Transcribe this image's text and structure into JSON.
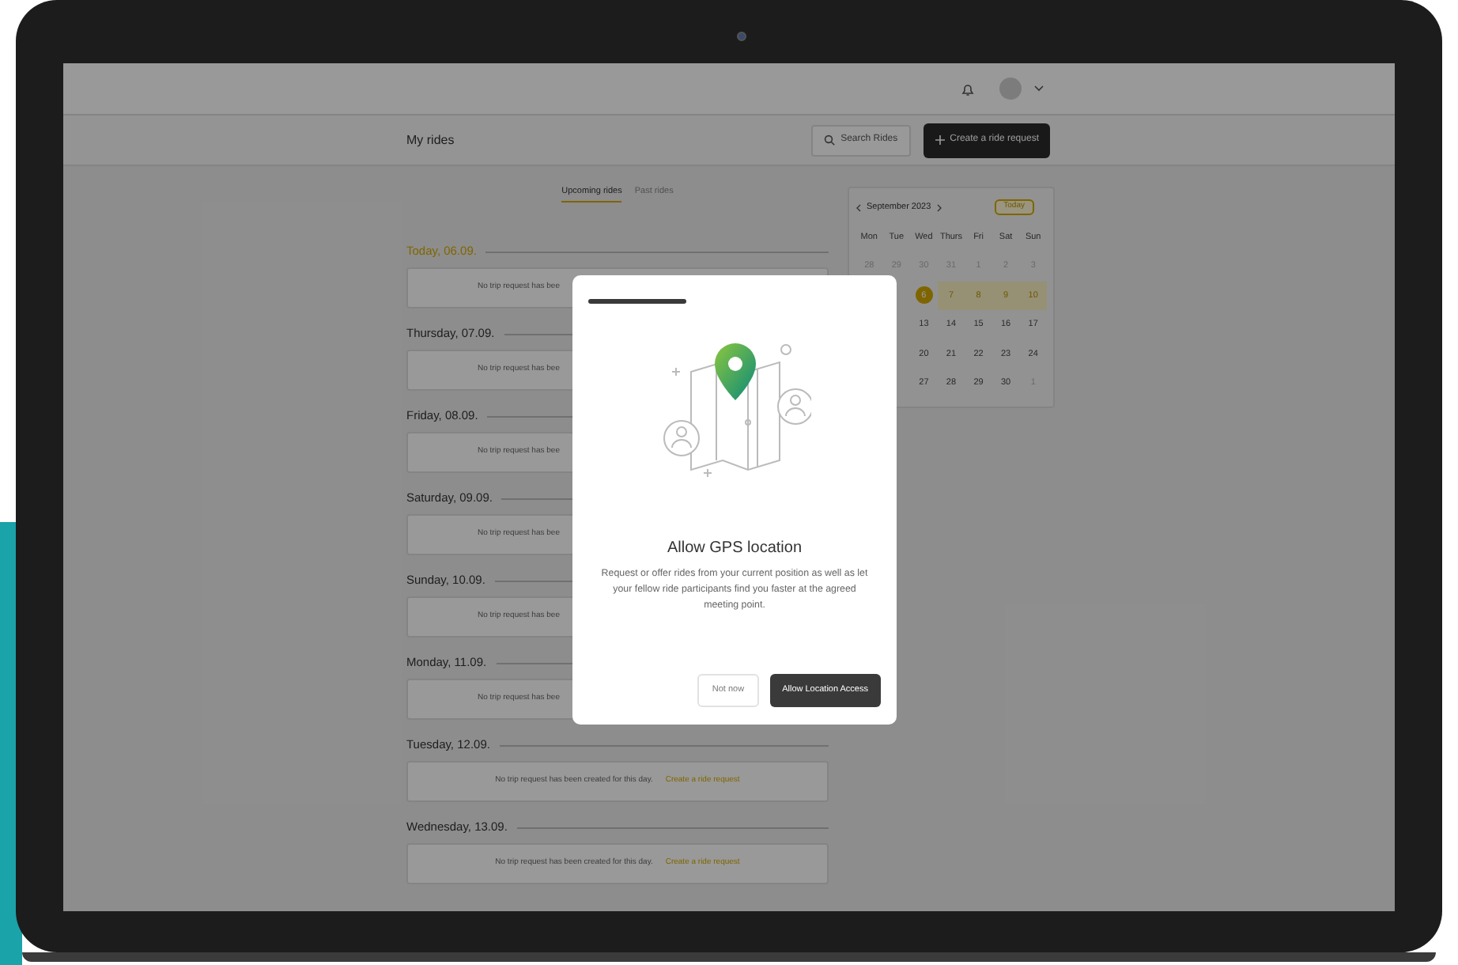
{
  "page_title": "My rides",
  "search_button": "Search Rides",
  "create_button": "Create a ride request",
  "tabs": [
    {
      "label": "Upcoming rides",
      "selected": true
    },
    {
      "label": "Past rides",
      "selected": false
    }
  ],
  "days": [
    {
      "heading": "Today, 06.09.",
      "today": true,
      "message": "No trip request has bee"
    },
    {
      "heading": "Thursday, 07.09.",
      "today": false,
      "message": "No trip request has bee"
    },
    {
      "heading": "Friday, 08.09.",
      "today": false,
      "message": "No trip request has bee"
    },
    {
      "heading": "Saturday, 09.09.",
      "today": false,
      "message": "No trip request has bee"
    },
    {
      "heading": "Sunday, 10.09.",
      "today": false,
      "message": "No trip request has bee"
    },
    {
      "heading": "Monday, 11.09.",
      "today": false,
      "message": "No trip request has bee"
    },
    {
      "heading": "Tuesday, 12.09.",
      "today": false,
      "message": "No trip request has been created for this day.",
      "link": "Create a ride request"
    },
    {
      "heading": "Wednesday, 13.09.",
      "today": false,
      "message": "No trip request has been created for this day.",
      "link": "Create a ride request"
    }
  ],
  "calendar": {
    "month": "September 2023",
    "today_button": "Today",
    "weekdays": [
      "Mon",
      "Tue",
      "Wed",
      "Thurs",
      "Fri",
      "Sat",
      "Sun"
    ],
    "weeks": [
      [
        {
          "text": "28",
          "muted": true,
          "selected": false,
          "highlighted": false
        },
        {
          "text": "29",
          "muted": true,
          "selected": false,
          "highlighted": false
        },
        {
          "text": "30",
          "muted": true,
          "selected": false,
          "highlighted": false
        },
        {
          "text": "31",
          "muted": true,
          "selected": false,
          "highlighted": false
        },
        {
          "text": "1",
          "muted": true,
          "selected": false,
          "highlighted": false
        },
        {
          "text": "2",
          "muted": true,
          "selected": false,
          "highlighted": false
        },
        {
          "text": "3",
          "muted": true,
          "selected": false,
          "highlighted": false
        }
      ],
      [
        {
          "text": "6",
          "muted": false,
          "selected": true,
          "highlighted": false
        },
        {
          "text": "7",
          "muted": false,
          "selected": false,
          "highlighted": true
        },
        {
          "text": "8",
          "muted": false,
          "selected": false,
          "highlighted": true
        },
        {
          "text": "9",
          "muted": false,
          "selected": false,
          "highlighted": true
        },
        {
          "text": "10",
          "muted": false,
          "selected": false,
          "highlighted": true
        }
      ],
      [
        {
          "text": "13",
          "muted": false,
          "selected": false,
          "highlighted": false
        },
        {
          "text": "14",
          "muted": false,
          "selected": false,
          "highlighted": false
        },
        {
          "text": "15",
          "muted": false,
          "selected": false,
          "highlighted": false
        },
        {
          "text": "16",
          "muted": false,
          "selected": false,
          "highlighted": false
        },
        {
          "text": "17",
          "muted": false,
          "selected": false,
          "highlighted": false
        }
      ],
      [
        {
          "text": "20",
          "muted": false,
          "selected": false,
          "highlighted": false
        },
        {
          "text": "21",
          "muted": false,
          "selected": false,
          "highlighted": false
        },
        {
          "text": "22",
          "muted": false,
          "selected": false,
          "highlighted": false
        },
        {
          "text": "23",
          "muted": false,
          "selected": false,
          "highlighted": false
        },
        {
          "text": "24",
          "muted": false,
          "selected": false,
          "highlighted": false
        }
      ],
      [
        {
          "text": "27",
          "muted": false,
          "selected": false,
          "highlighted": false
        },
        {
          "text": "28",
          "muted": false,
          "selected": false,
          "highlighted": false
        },
        {
          "text": "29",
          "muted": false,
          "selected": false,
          "highlighted": false
        },
        {
          "text": "30",
          "muted": false,
          "selected": false,
          "highlighted": false
        },
        {
          "text": "1",
          "muted": true,
          "selected": false,
          "highlighted": false
        }
      ]
    ]
  },
  "modal": {
    "title": "Allow GPS location",
    "body": "Request or offer rides from your current position as well as let your fellow ride participants find you faster at the agreed meeting point.",
    "buttons": [
      {
        "label": "Not now",
        "kind": "secondary"
      },
      {
        "label": "Allow Location Access",
        "kind": "primary"
      }
    ]
  }
}
